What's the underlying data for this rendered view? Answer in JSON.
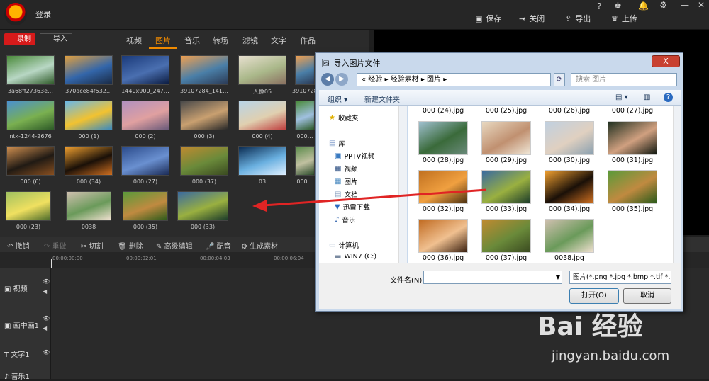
{
  "app": {
    "login": "登录",
    "top_actions": [
      {
        "label": "保存",
        "icon": "save-icon",
        "glyph": "🖫"
      },
      {
        "label": "关闭",
        "icon": "exit-icon",
        "glyph": "⇥"
      },
      {
        "label": "导出",
        "icon": "export-icon",
        "glyph": "⇪"
      },
      {
        "label": "上传",
        "icon": "crown-icon",
        "glyph": "♛"
      }
    ]
  },
  "left_panel": {
    "record_label": "录制",
    "import_label": "导入",
    "tabs": [
      {
        "label": "视频"
      },
      {
        "label": "图片",
        "active": true
      },
      {
        "label": "音乐"
      },
      {
        "label": "转场"
      },
      {
        "label": "滤镜"
      },
      {
        "label": "文字"
      },
      {
        "label": "作品"
      }
    ],
    "media_items": [
      {
        "label": "3a68ff27363e…",
        "colors": [
          "#4a8a3a",
          "#b8d7c4",
          "#2e5a28"
        ]
      },
      {
        "label": "370ace84f532…",
        "colors": [
          "#e0a040",
          "#3366aa",
          "#1a2a44"
        ]
      },
      {
        "label": "1440x900_247…",
        "colors": [
          "#1a3a7a",
          "#4a6fb0",
          "#0b1b3f"
        ]
      },
      {
        "label": "39107284_141…",
        "colors": [
          "#f0a050",
          "#4a7fa8",
          "#2b3a55"
        ]
      },
      {
        "label": "人像05",
        "colors": [
          "#e8e0d0",
          "#aab88a",
          "#8a7060"
        ]
      },
      {
        "label": "39107284…",
        "colors": [
          "#f0a050",
          "#4a7fa8",
          "#2b3a55"
        ]
      },
      {
        "label": "ntk-1244-2676",
        "colors": [
          "#4a90d0",
          "#7ab050",
          "#2e5a28"
        ]
      },
      {
        "label": "000 (1)",
        "colors": [
          "#69b7e8",
          "#f2c230",
          "#3a8ac0"
        ]
      },
      {
        "label": "000 (2)",
        "colors": [
          "#b090c0",
          "#e0a0a0",
          "#6a5a7a"
        ]
      },
      {
        "label": "000 (3)",
        "colors": [
          "#4a4a4a",
          "#c9a070",
          "#2a2a2a"
        ]
      },
      {
        "label": "000 (4)",
        "colors": [
          "#b8d4e8",
          "#e0d0b0",
          "#c04040"
        ]
      },
      {
        "label": "000…",
        "colors": [
          "#4a8a3a",
          "#a0c0e0",
          "#2e5a28"
        ]
      },
      {
        "label": "000 (6)",
        "colors": [
          "#d09050",
          "#201a14",
          "#8a5020"
        ]
      },
      {
        "label": "000 (34)",
        "colors": [
          "#f0a030",
          "#1a1008",
          "#d07020"
        ]
      },
      {
        "label": "000 (27)",
        "colors": [
          "#2a4a8a",
          "#6a90d0",
          "#1a2a55"
        ]
      },
      {
        "label": "000 (37)",
        "colors": [
          "#c08a30",
          "#6a8a3a",
          "#3a4a20"
        ]
      },
      {
        "label": "03",
        "colors": [
          "#0a2a50",
          "#6ab0e0",
          "#e0f0ff"
        ]
      },
      {
        "label": "000…",
        "colors": [
          "#5a8a4a",
          "#c0c0a0",
          "#2a4a2a"
        ]
      },
      {
        "label": "000 (23)",
        "colors": [
          "#a0c060",
          "#f0e060",
          "#4a6a2a"
        ]
      },
      {
        "label": "0038",
        "colors": [
          "#d0c0b0",
          "#6a9a5a",
          "#f0e0d0"
        ]
      },
      {
        "label": "000 (35)",
        "colors": [
          "#5a9a3a",
          "#c08a40",
          "#2a5a1a"
        ]
      },
      {
        "label": "000 (33)",
        "colors": [
          "#3a6aa0",
          "#9ab040",
          "#1a3a2a"
        ]
      }
    ]
  },
  "toolbar": {
    "undo": "撤销",
    "redo": "重做",
    "cut": "切割",
    "delete": "删除",
    "advanced": "高级编辑",
    "dub": "配音",
    "generate": "生成素材"
  },
  "timeline": {
    "ticks": [
      "00:00:00:00",
      "00:00:02:01",
      "00:00:04:03",
      "00:00:06:04"
    ],
    "tracks": [
      {
        "label": "视频"
      },
      {
        "label": "画中画1"
      },
      {
        "label": "文字1"
      },
      {
        "label": "音乐1"
      }
    ]
  },
  "dialog": {
    "title": "导入图片文件",
    "close_label": "X",
    "address": "« 经验 ▸ 经验素材 ▸ 图片 ▸",
    "search_placeholder": "搜索 图片",
    "organize": "组织 ▾",
    "new_folder": "新建文件夹",
    "nav": [
      {
        "label": "收藏夹",
        "icon": "favorites-icon",
        "glyph": "★",
        "color": "#e0b000"
      },
      {
        "label": "库",
        "icon": "library-icon",
        "glyph": "▤",
        "color": "#6a8ac0"
      },
      {
        "label": "PPTV视频",
        "icon": "folder-icon",
        "glyph": "▣",
        "color": "#3a7ac0"
      },
      {
        "label": "视频",
        "icon": "video-icon",
        "glyph": "▦",
        "color": "#3a5a8a"
      },
      {
        "label": "图片",
        "icon": "picture-icon",
        "glyph": "▦",
        "color": "#4a8ac0"
      },
      {
        "label": "文档",
        "icon": "document-icon",
        "glyph": "▤",
        "color": "#8aa0c0"
      },
      {
        "label": "迅雷下载",
        "icon": "download-icon",
        "glyph": "▼",
        "color": "#2a6ac0"
      },
      {
        "label": "音乐",
        "icon": "music-icon",
        "glyph": "♪",
        "color": "#3a6ab0"
      },
      {
        "label": "计算机",
        "icon": "computer-icon",
        "glyph": "▭",
        "color": "#5a7aa0"
      },
      {
        "label": "WIN7 (C:)",
        "icon": "drive-icon",
        "glyph": "▬",
        "color": "#7a8aa0"
      }
    ],
    "header_labels": [
      "000 (24).jpg",
      "000 (25).jpg",
      "000 (26).jpg",
      "000 (27).jpg"
    ],
    "files": [
      {
        "label": "000 (28).jpg",
        "colors": [
          "#a0c0d0",
          "#3a6a3a",
          "#6a8a7a"
        ]
      },
      {
        "label": "000 (29).jpg",
        "colors": [
          "#e8d8c0",
          "#c09070",
          "#f0e8d8"
        ]
      },
      {
        "label": "000 (30).jpg",
        "colors": [
          "#c0d0e0",
          "#e0d0c0",
          "#8aa0b0"
        ]
      },
      {
        "label": "000 (31).jpg",
        "colors": [
          "#203020",
          "#d0a080",
          "#101810"
        ]
      },
      {
        "label": "000 (32).jpg",
        "colors": [
          "#c07020",
          "#f0a040",
          "#4a3010"
        ]
      },
      {
        "label": "000 (33).jpg",
        "colors": [
          "#3a6aa0",
          "#9ab040",
          "#1a3a2a"
        ]
      },
      {
        "label": "000 (34).jpg",
        "colors": [
          "#f0a030",
          "#1a1008",
          "#d07020"
        ]
      },
      {
        "label": "000 (35).jpg",
        "colors": [
          "#5a9a3a",
          "#c08a40",
          "#2a5a1a"
        ]
      },
      {
        "label": "000 (36).jpg",
        "colors": [
          "#c06a20",
          "#f0c090",
          "#3a2010"
        ]
      },
      {
        "label": "000 (37).jpg",
        "colors": [
          "#c08a30",
          "#6a8a3a",
          "#3a4a20"
        ]
      },
      {
        "label": "0038.jpg",
        "colors": [
          "#d0c0b0",
          "#6a9a5a",
          "#f0e0d0"
        ]
      }
    ],
    "filename_label": "文件名(N):",
    "filename_value": "",
    "filetype": "图片(*.png *.jpg *.bmp *.tif *.",
    "open_label": "打开(O)",
    "cancel_label": "取消"
  },
  "watermark": {
    "line1": "Bai 经验",
    "line2": "jingyan.baidu.com"
  }
}
